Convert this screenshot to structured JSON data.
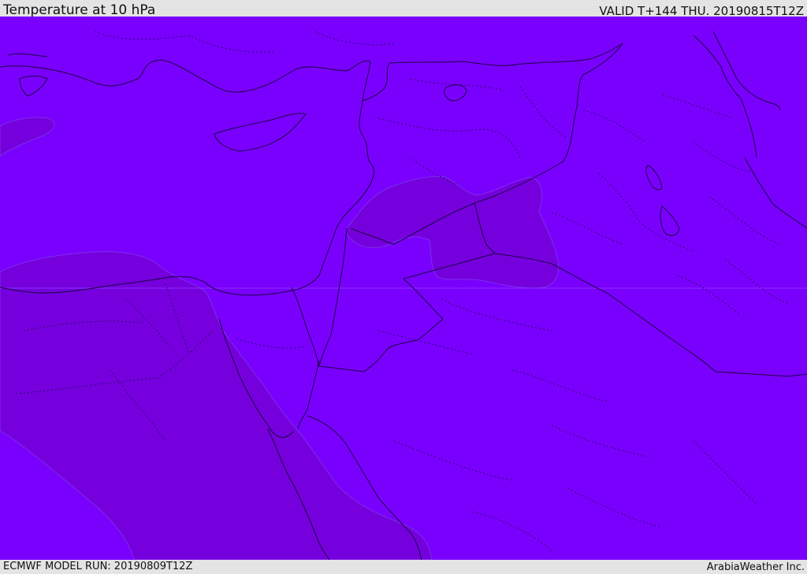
{
  "header": {
    "title": "Temperature at 10 hPa",
    "valid_time": "VALID T+144 THU. 20190815T12Z"
  },
  "footer": {
    "model_run": "ECMWF MODEL RUN: 20190809T12Z",
    "credit": "ArabiaWeather Inc."
  },
  "colors": {
    "warm_field": "#7a00fe",
    "cool_field": "#7500dd",
    "borders": "#1a0040",
    "bars": "#e4e4e4"
  },
  "map": {
    "variable": "Temperature",
    "level": "10 hPa",
    "region": "Eastern Mediterranean and Middle East"
  }
}
